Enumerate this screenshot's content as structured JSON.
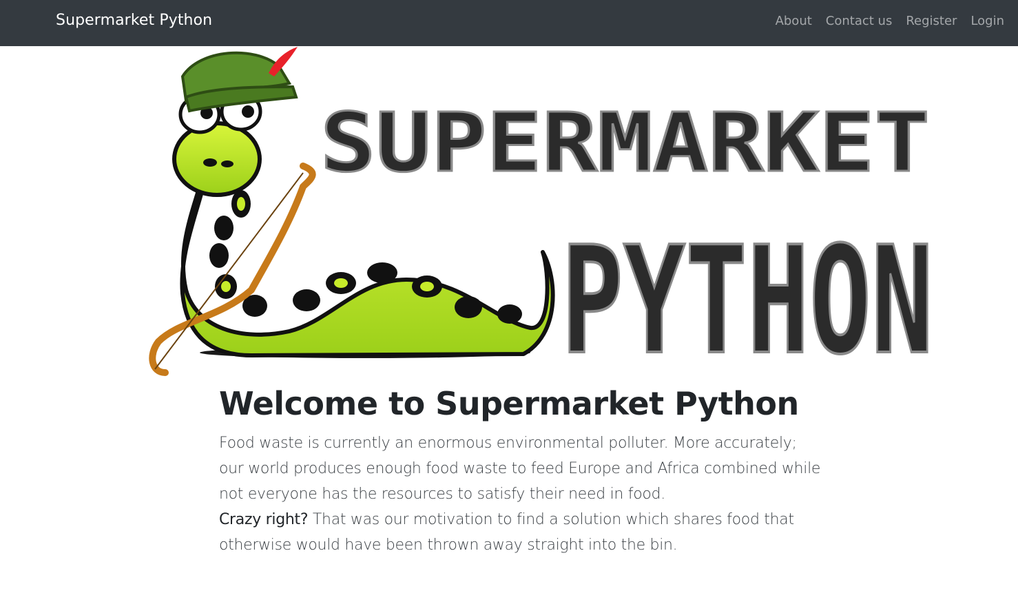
{
  "navbar": {
    "brand": "Supermarket Python",
    "links": [
      "About",
      "Contact us",
      "Register",
      "Login"
    ],
    "background": "#343a40"
  },
  "logo": {
    "line1": "SUPERMARKET",
    "line2": "PYTHON",
    "colors": {
      "snake": "#b6e31a",
      "hat": "#5a8f2a",
      "bow": "#c77a1a",
      "feather": "#e8212a",
      "letters": "#2b2b2b"
    }
  },
  "main": {
    "heading": "Welcome to Supermarket Python",
    "paragraph_1": "Food waste is currently an enormous environmental polluter. More accurately; our world produces enough food waste to feed Europe and Africa combined while not everyone has the resources to satisfy their need in food.",
    "emphasis": "Crazy right?",
    "paragraph_2": " That was our motivation to find a solution which shares food that otherwise would have been thrown away straight into the bin."
  }
}
